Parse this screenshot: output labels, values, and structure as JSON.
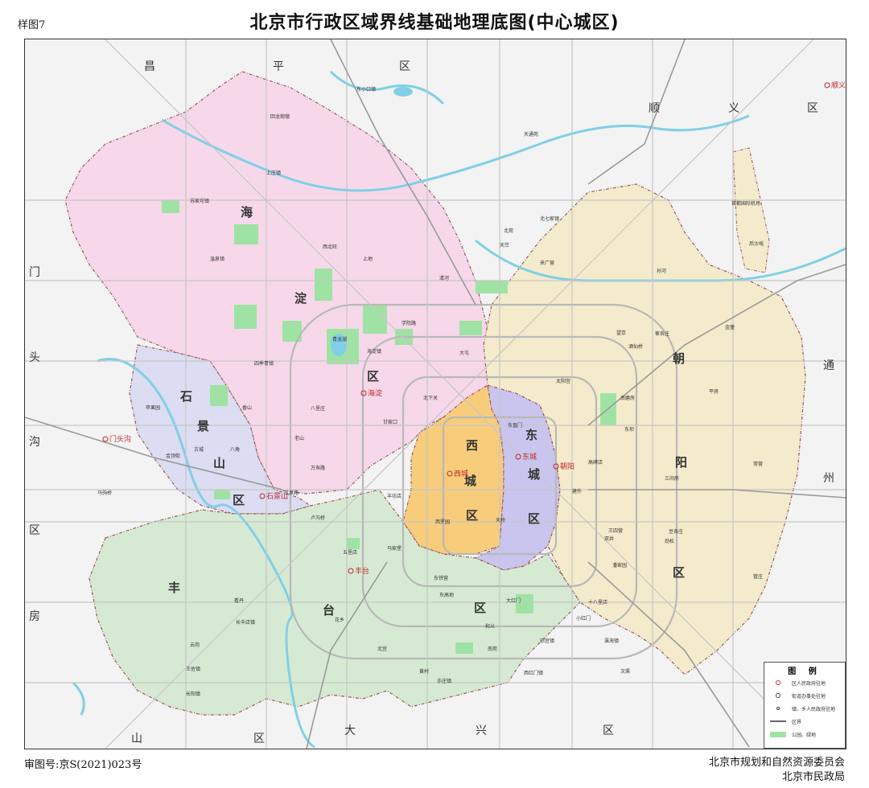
{
  "sample_label": "样图7",
  "title": "北京市行政区域界线基础地理底图(中心城区)",
  "footer": {
    "review_number": "审图号:京S(2021)023号",
    "issuer_1": "北京市规划和自然资源委员会",
    "issuer_2": "北京市民政局"
  },
  "districts": {
    "haidian": [
      "海",
      "淀",
      "区"
    ],
    "shijingshan": [
      "石",
      "景",
      "山",
      "区"
    ],
    "xicheng": [
      "西",
      "城",
      "区"
    ],
    "dongcheng": [
      "东",
      "城",
      "区"
    ],
    "chaoyang": [
      "朝",
      "阳",
      "区"
    ],
    "fengtai": [
      "丰",
      "台",
      "区"
    ]
  },
  "outer_districts": {
    "changping": [
      "昌",
      "平",
      "区"
    ],
    "shunyi": [
      "顺",
      "义",
      "区"
    ],
    "tongzhou": [
      "通",
      "州",
      "区"
    ],
    "mentougou": [
      "门",
      "头",
      "沟",
      "区"
    ],
    "fangshan": [
      "房",
      "山",
      "区"
    ],
    "daxing": [
      "大",
      "兴",
      "区"
    ]
  },
  "government_seats": {
    "haidian": "海淀",
    "shijingshan": "石景山",
    "xicheng": "西城",
    "dongcheng": "东城",
    "chaoyang": "朝阳",
    "fengtai": "丰台",
    "mentougou": "门头沟",
    "shunyi": "顺义"
  },
  "places": {
    "xibeiwang": "西北旺",
    "sujiatuo": "苏家坨镇",
    "wenquan": "温泉镇",
    "shangzhuang": "上庄镇",
    "xiangshan": "香山",
    "sijiqing": "四季青镇",
    "shangdi": "上地",
    "qinghe": "清河",
    "xueyuanlu": "学院路",
    "qinglonghu": "青龙湖",
    "haidianzhen": "海淀镇",
    "beixiaguan": "北下关",
    "ganjiakou": "甘家口",
    "balizhuang": "八里庄",
    "wanshoulu": "万寿路",
    "yangfangdian": "羊坊店",
    "laoshan": "老山",
    "gucheng": "古城",
    "pingguoyuan": "苹果园",
    "bajiao": "八角",
    "jinding": "金顶街",
    "lugouqiao": "卢沟桥",
    "wulidian": "五里店",
    "kandan": "看丹",
    "huaxiang": "花乡",
    "nanyuan": "南苑",
    "dahongmen": "大红门",
    "heyi": "和义",
    "donggaodi": "东高地",
    "wangzuo": "王佐镇",
    "changxindian": "长辛店镇",
    "yungang": "云岗",
    "beigongsi": "北宫",
    "dongtiejiangying": "东铁营",
    "majiapu": "马家堡",
    "xiluoyuan": "西罗园",
    "yuquanlu": "玉泉路",
    "tianqiao": "天桥",
    "dongzhimen": "东直门",
    "jianwai": "建外",
    "wangjing": "望京",
    "jiuxianqiao": "酒仙桥",
    "sanjianfang": "三间房",
    "dougezhuang": "豆各庄",
    "wangsiying": "王四营",
    "shibalidian": "十八里店",
    "xiaohongmen": "小红门",
    "laiguangying": "来广营",
    "beiyuan": "北苑",
    "datun": "大屯",
    "taiyanggong": "太阳宫",
    "sunhe": "孙河",
    "cuigezhuang": "崔各庄",
    "jinzhan": "金盏",
    "pingfang": "平房",
    "changying": "常营",
    "guanzhuang": "管庄",
    "nanmofang": "南磨房",
    "gaobeidian": "高碑店",
    "dongba": "东坝",
    "shuangjing": "双井",
    "panjiayuan": "潘家园",
    "jinsong": "劲松",
    "huilongguan": "回龙观镇",
    "dongxiaokou": "东小口镇",
    "tiantongyuan": "天通苑",
    "beiqijia": "北七家镇",
    "houshayu": "后沙峪",
    "airport": "首都国际机场",
    "tianzhu": "天竺",
    "yinghaizhen": "瀛海镇",
    "jiugong": "旧宫镇",
    "yizhuang": "亦庄镇",
    "xihongmen": "西红门镇",
    "huangcun": "黄村",
    "changyang": "长阳镇",
    "ciqu": "次渠",
    "majuqiao": "马驹桥"
  },
  "legend": {
    "title": "图 例",
    "items": [
      "区人民政府驻地",
      "街道办事处驻地",
      "镇、乡人民政府驻地",
      "区界",
      "公园、绿地"
    ]
  }
}
